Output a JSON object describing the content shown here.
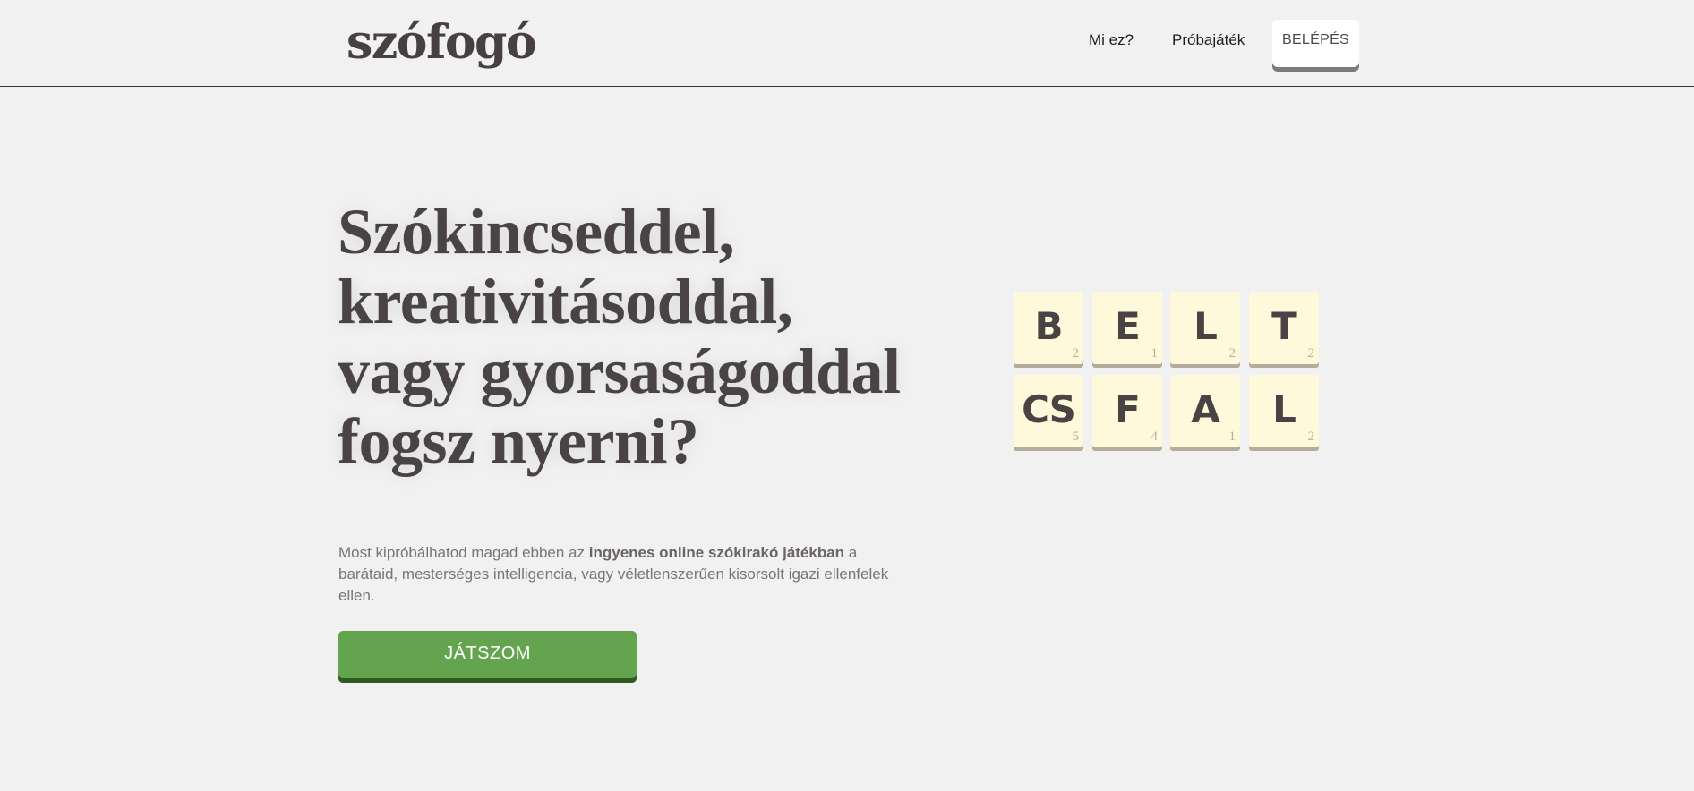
{
  "header": {
    "logo": "szófogó",
    "nav": [
      {
        "label": "Mi ez?"
      },
      {
        "label": "Próbajáték"
      }
    ],
    "login_label": "BELÉPÉS"
  },
  "hero": {
    "title": "Szókincseddel, kreativitásoddal, vagy gyorsaságoddal fogsz nyerni?",
    "desc_before": "Most kipróbálhatod magad ebben az ",
    "desc_bold": "ingyenes online szókirakó játékban",
    "desc_after": " a barátaid, mesterséges intelligencia, vagy véletlenszerűen kisorsolt igazi ellenfelek ellen.",
    "cta_label": "JÁTSZOM"
  },
  "tiles": {
    "row1": [
      {
        "letter": "B",
        "score": "2"
      },
      {
        "letter": "E",
        "score": "1"
      },
      {
        "letter": "L",
        "score": "2"
      },
      {
        "letter": "T",
        "score": "2"
      }
    ],
    "row2": [
      {
        "letter": "CS",
        "score": "5"
      },
      {
        "letter": "F",
        "score": "4"
      },
      {
        "letter": "A",
        "score": "1"
      },
      {
        "letter": "L",
        "score": "2"
      }
    ]
  },
  "colors": {
    "background": "#f1f1f1",
    "play_button": "#65a44f",
    "tile": "#fff9dc",
    "text": "#4a4343"
  }
}
